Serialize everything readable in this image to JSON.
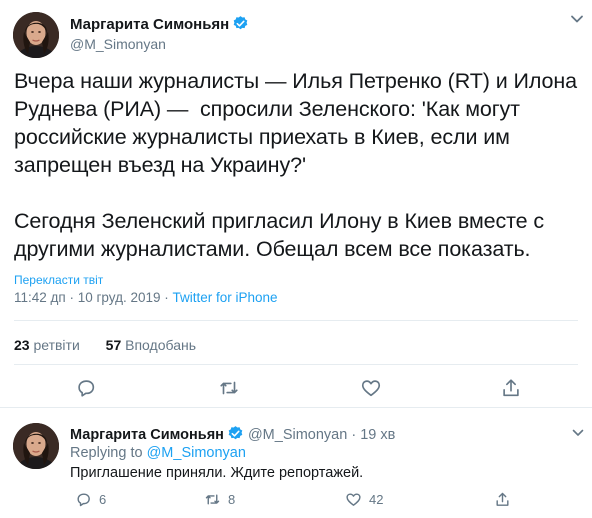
{
  "main_tweet": {
    "author_name": "Маргарита Симоньян",
    "author_handle": "@M_Simonyan",
    "text": "Вчера наши журналисты — Илья Петренко (RT) и Илона\nРуднева (РИА) —  спросили Зеленского: 'Как могут\nроссийские журналисты приехать в Киев, если им\nзапрещен въезд на Украину?'\n\nСегодня Зеленский пригласил Илону в Киев вместе с\nдругими журналистами. Обещал всем все показать.",
    "translate_label": "Перекласти твіт",
    "timestamp": "11:42 дп · 10 груд. 2019 · ",
    "source": "Twitter for iPhone",
    "retweets_count": "23",
    "retweets_label": "ретвіти",
    "likes_count": "57",
    "likes_label": "Вподобань",
    "icons": [
      "reply-icon",
      "retweet-icon",
      "like-icon",
      "share-icon",
      "verified-icon",
      "chevron-down-icon"
    ]
  },
  "reply_tweet": {
    "author_name": "Маргарита Симоньян",
    "author_handle": "@M_Simonyan",
    "separator": " · ",
    "time": "19 хв",
    "replying_to_label": "Replying to ",
    "replying_to_handle": "@M_Simonyan",
    "text": "Приглашение приняли. Ждите репортажей.",
    "reply_count": "6",
    "retweet_count": "8",
    "like_count": "42"
  },
  "colors": {
    "accent": "#1da1f2",
    "secondary_text": "#657786",
    "border": "#e6ecf0",
    "verified": "#1da1f2"
  }
}
